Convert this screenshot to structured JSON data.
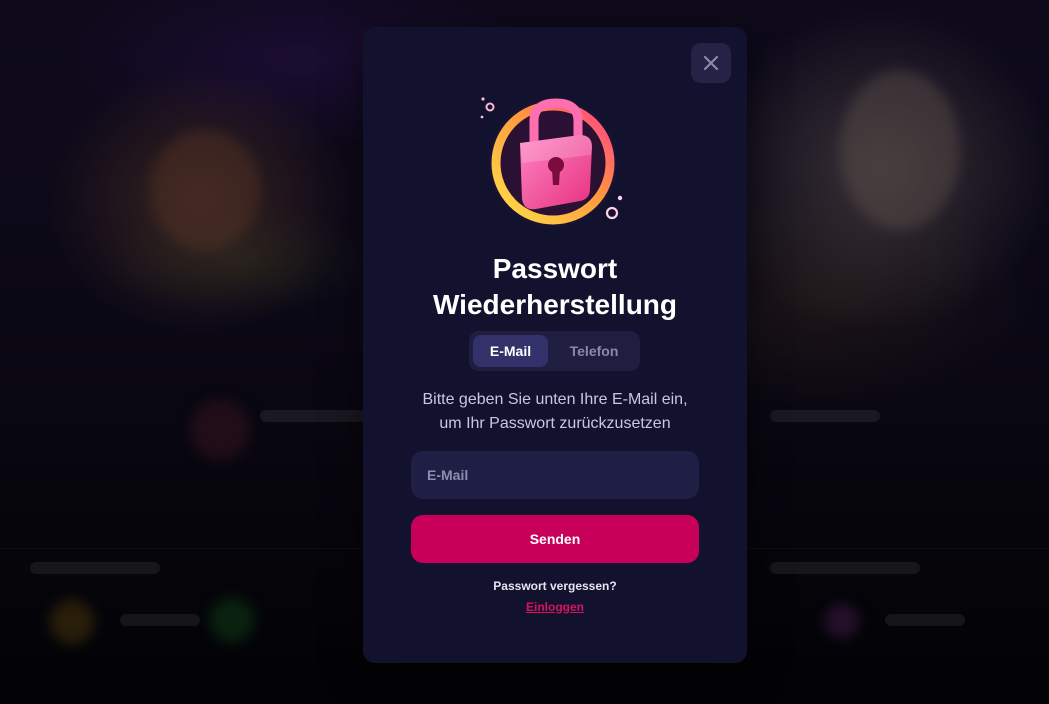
{
  "modal": {
    "title_line1": "Passwort",
    "title_line2": "Wiederherstellung",
    "tabs": [
      {
        "label": "E-Mail",
        "active": true
      },
      {
        "label": "Telefon",
        "active": false
      }
    ],
    "description_line1": "Bitte geben Sie unten Ihre E-Mail ein,",
    "description_line2": "um Ihr Passwort zurückzusetzen",
    "email_field": {
      "placeholder": "E-Mail",
      "value": ""
    },
    "submit_label": "Senden",
    "forgot_text": "Passwort vergessen?",
    "login_link": "Einloggen",
    "close_icon": "close-icon",
    "illustration_icon": "padlock-icon"
  },
  "colors": {
    "modal_bg": "#13122e",
    "primary": "#c8005a",
    "link": "#d8125f",
    "tab_active": "#33316a"
  }
}
